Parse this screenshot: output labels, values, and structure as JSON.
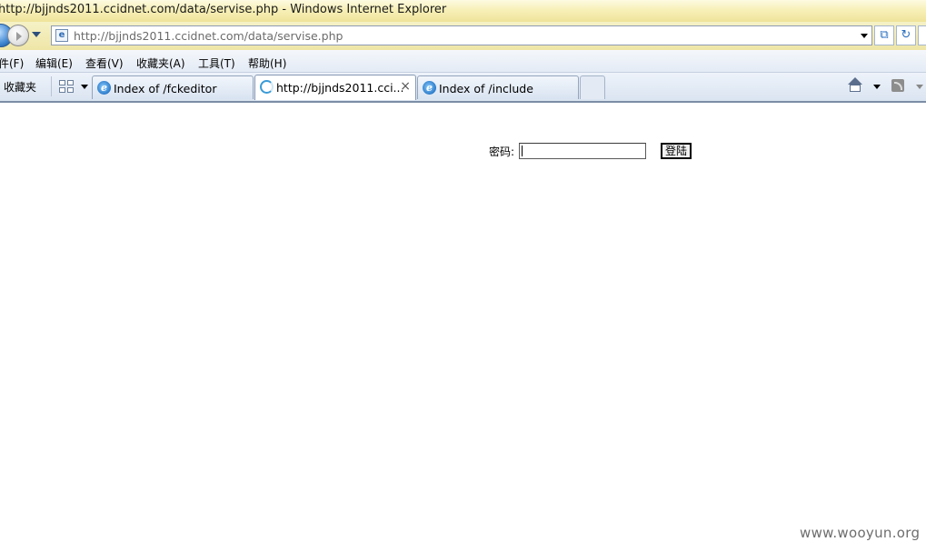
{
  "window": {
    "title": "http://bjjnds2011.ccidnet.com/data/servise.php - Windows Internet Explorer"
  },
  "address_bar": {
    "url": "http://bjjnds2011.ccidnet.com/data/servise.php"
  },
  "menu": {
    "items": [
      "件(F)",
      "编辑(E)",
      "查看(V)",
      "收藏夹(A)",
      "工具(T)",
      "帮助(H)"
    ]
  },
  "favorites_bar": {
    "label": "收藏夹"
  },
  "tabs": [
    {
      "label": "Index of /fckeditor",
      "active": false
    },
    {
      "label": "http://bjjnds2011.cci...",
      "active": true,
      "close": "×"
    },
    {
      "label": "Index of /include",
      "active": false
    }
  ],
  "page": {
    "password_label": "密码:",
    "password_value": "",
    "login_button": "登陆"
  },
  "watermark": "www.wooyun.org",
  "colors": {
    "titlebar": "#f7f0b8",
    "toolbar": "#e4ebf5",
    "accent": "#2a79c9"
  }
}
